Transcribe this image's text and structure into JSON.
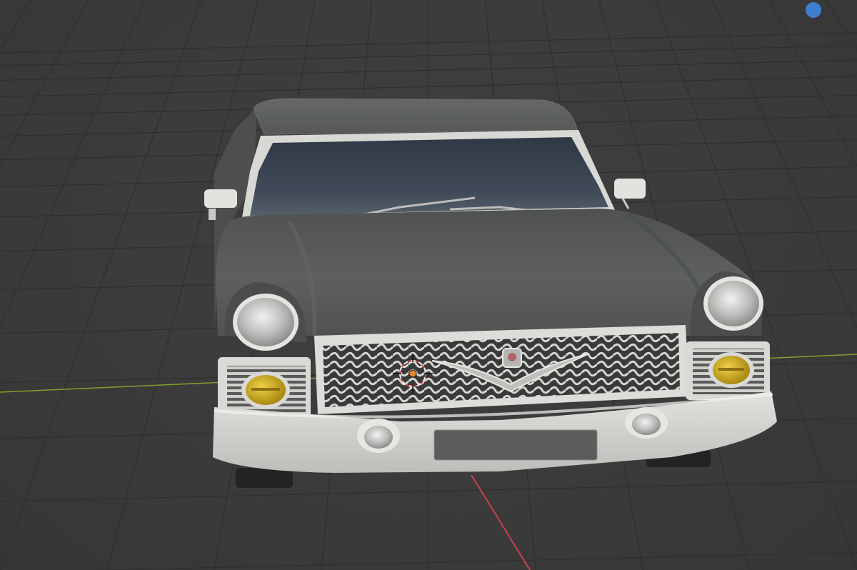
{
  "app": {
    "name": "3D Viewport",
    "view": "perspective",
    "grid": true
  },
  "colors": {
    "background": "#3b3b3b",
    "grid_line": "#2f2f2f",
    "x_axis": "#c9414e",
    "y_axis": "#7fa12e",
    "gizmo_dot": "#3f7fd0",
    "car_body": "#585b5a",
    "car_roof": "#5e6160",
    "windshield": "#3b4552",
    "chrome": "#d8d8d5",
    "fog_lamp": "#c9a617",
    "cursor_ring": "#d34a4a"
  },
  "scene": {
    "object": "car-model",
    "cursor_3d": "3d-cursor"
  },
  "icons": {
    "navigation_gizmo": "gizmo-axis-dot-icon",
    "cursor": "3d-cursor-icon"
  }
}
